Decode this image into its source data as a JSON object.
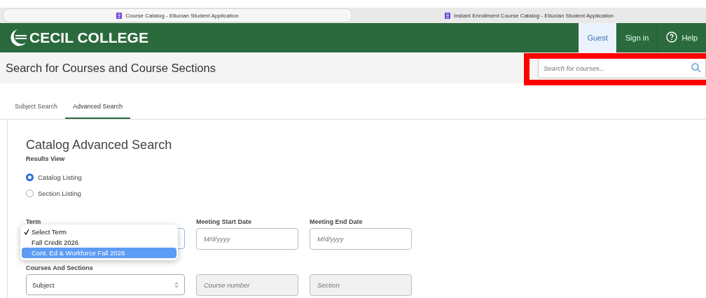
{
  "browser_tabs": [
    {
      "title": "Course Catalog - Ellucian Student Application",
      "selected": true
    },
    {
      "title": "Instant Enrollment Course Catalog - Ellucian Student Application",
      "selected": false
    }
  ],
  "header": {
    "logo_text": "CECIL COLLEGE",
    "nav": [
      {
        "label": "Guest",
        "selected": true,
        "kind": "text"
      },
      {
        "label": "Sign in",
        "selected": false,
        "kind": "text"
      },
      {
        "label": "Help",
        "selected": false,
        "kind": "help"
      }
    ]
  },
  "page_title": "Search for Courses and Course Sections",
  "search": {
    "placeholder": "Search for courses..."
  },
  "tabs": [
    {
      "label": "Subject Search",
      "selected": false
    },
    {
      "label": "Advanced Search",
      "selected": true
    }
  ],
  "form": {
    "title": "Catalog Advanced Search",
    "results_view_label": "Results View",
    "results_view": [
      {
        "label": "Catalog Listing",
        "selected": true
      },
      {
        "label": "Section Listing",
        "selected": false
      }
    ],
    "term_label": "Term",
    "term_options": [
      {
        "label": "Select Term",
        "checked": true,
        "selected": false
      },
      {
        "label": "Fall Credit 2026",
        "checked": false,
        "selected": false
      },
      {
        "label": "Cont. Ed & Workforce Fall 2026",
        "checked": false,
        "selected": true
      }
    ],
    "start_date": {
      "label": "Meeting Start Date",
      "placeholder": "M/d/yyyy"
    },
    "end_date": {
      "label": "Meeting End Date",
      "placeholder": "M/d/yyyy"
    },
    "courses_label": "Courses And Sections",
    "subject": {
      "value": "Subject"
    },
    "course_number": {
      "placeholder": "Course number"
    },
    "section": {
      "placeholder": "Section"
    }
  }
}
